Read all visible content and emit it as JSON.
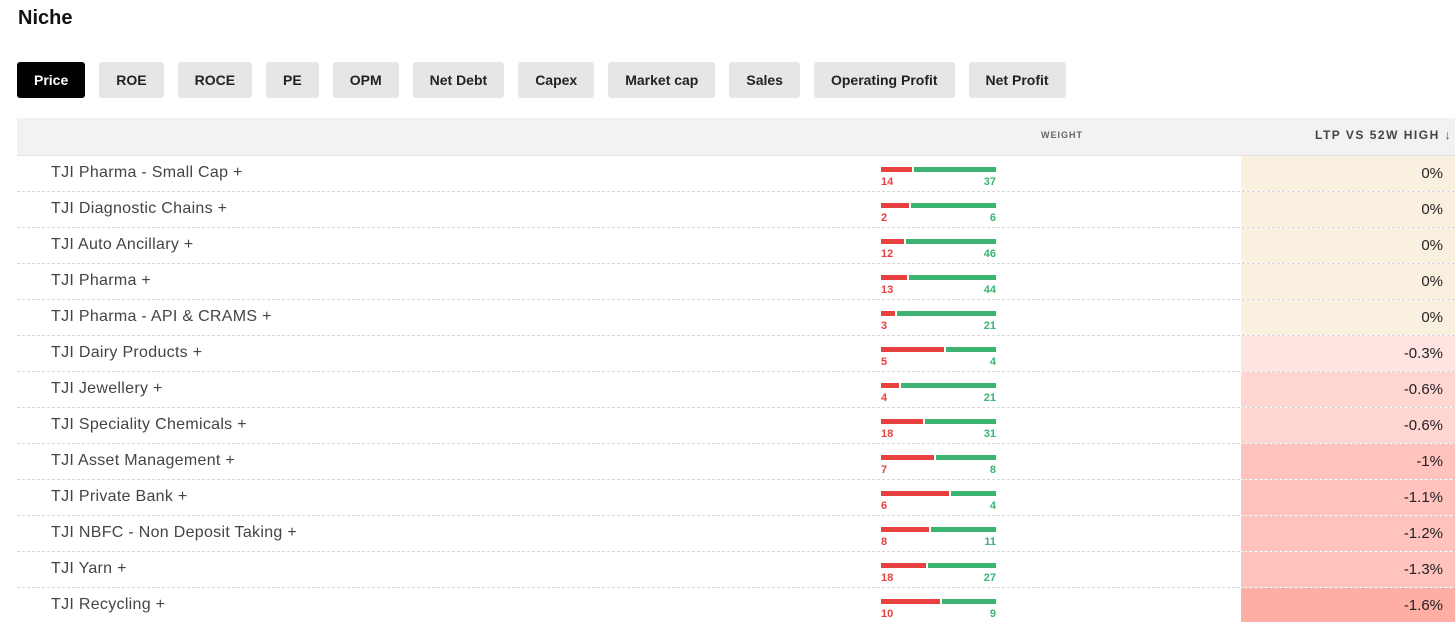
{
  "page": {
    "title": "Niche"
  },
  "tabs": [
    {
      "label": "Price",
      "active": true
    },
    {
      "label": "ROE",
      "active": false
    },
    {
      "label": "ROCE",
      "active": false
    },
    {
      "label": "PE",
      "active": false
    },
    {
      "label": "OPM",
      "active": false
    },
    {
      "label": "Net Debt",
      "active": false
    },
    {
      "label": "Capex",
      "active": false
    },
    {
      "label": "Market cap",
      "active": false
    },
    {
      "label": "Sales",
      "active": false
    },
    {
      "label": "Operating Profit",
      "active": false
    },
    {
      "label": "Net Profit",
      "active": false
    }
  ],
  "table": {
    "headers": {
      "weight": "WEIGHT",
      "ltp": "LTP VS 52W HIGH ↓"
    },
    "colors": {
      "red": "#e8403f",
      "green": "#3cb371",
      "neutral_bg": "#faf0e0",
      "neg_light": "#ffe4e1",
      "neg_mid": "#ffd6d2",
      "neg_strong": "#ffc2bc",
      "neg_stronger": "#ffaea4"
    },
    "rows": [
      {
        "name": "TJI Pharma - Small Cap +",
        "red": 14,
        "green": 37,
        "ltp": "0%",
        "ltp_value": 0
      },
      {
        "name": "TJI Diagnostic Chains +",
        "red": 2,
        "green": 6,
        "ltp": "0%",
        "ltp_value": 0
      },
      {
        "name": "TJI Auto Ancillary +",
        "red": 12,
        "green": 46,
        "ltp": "0%",
        "ltp_value": 0
      },
      {
        "name": "TJI Pharma +",
        "red": 13,
        "green": 44,
        "ltp": "0%",
        "ltp_value": 0
      },
      {
        "name": "TJI Pharma - API & CRAMS +",
        "red": 3,
        "green": 21,
        "ltp": "0%",
        "ltp_value": 0
      },
      {
        "name": "TJI Dairy Products +",
        "red": 5,
        "green": 4,
        "ltp": "-0.3%",
        "ltp_value": -0.3
      },
      {
        "name": "TJI Jewellery +",
        "red": 4,
        "green": 21,
        "ltp": "-0.6%",
        "ltp_value": -0.6
      },
      {
        "name": "TJI Speciality Chemicals +",
        "red": 18,
        "green": 31,
        "ltp": "-0.6%",
        "ltp_value": -0.6
      },
      {
        "name": "TJI Asset Management +",
        "red": 7,
        "green": 8,
        "ltp": "-1%",
        "ltp_value": -1
      },
      {
        "name": "TJI Private Bank +",
        "red": 6,
        "green": 4,
        "ltp": "-1.1%",
        "ltp_value": -1.1
      },
      {
        "name": "TJI NBFC - Non Deposit Taking +",
        "red": 8,
        "green": 11,
        "ltp": "-1.2%",
        "ltp_value": -1.2
      },
      {
        "name": "TJI Yarn +",
        "red": 18,
        "green": 27,
        "ltp": "-1.3%",
        "ltp_value": -1.3
      },
      {
        "name": "TJI Recycling +",
        "red": 10,
        "green": 9,
        "ltp": "-1.6%",
        "ltp_value": -1.6
      }
    ]
  }
}
